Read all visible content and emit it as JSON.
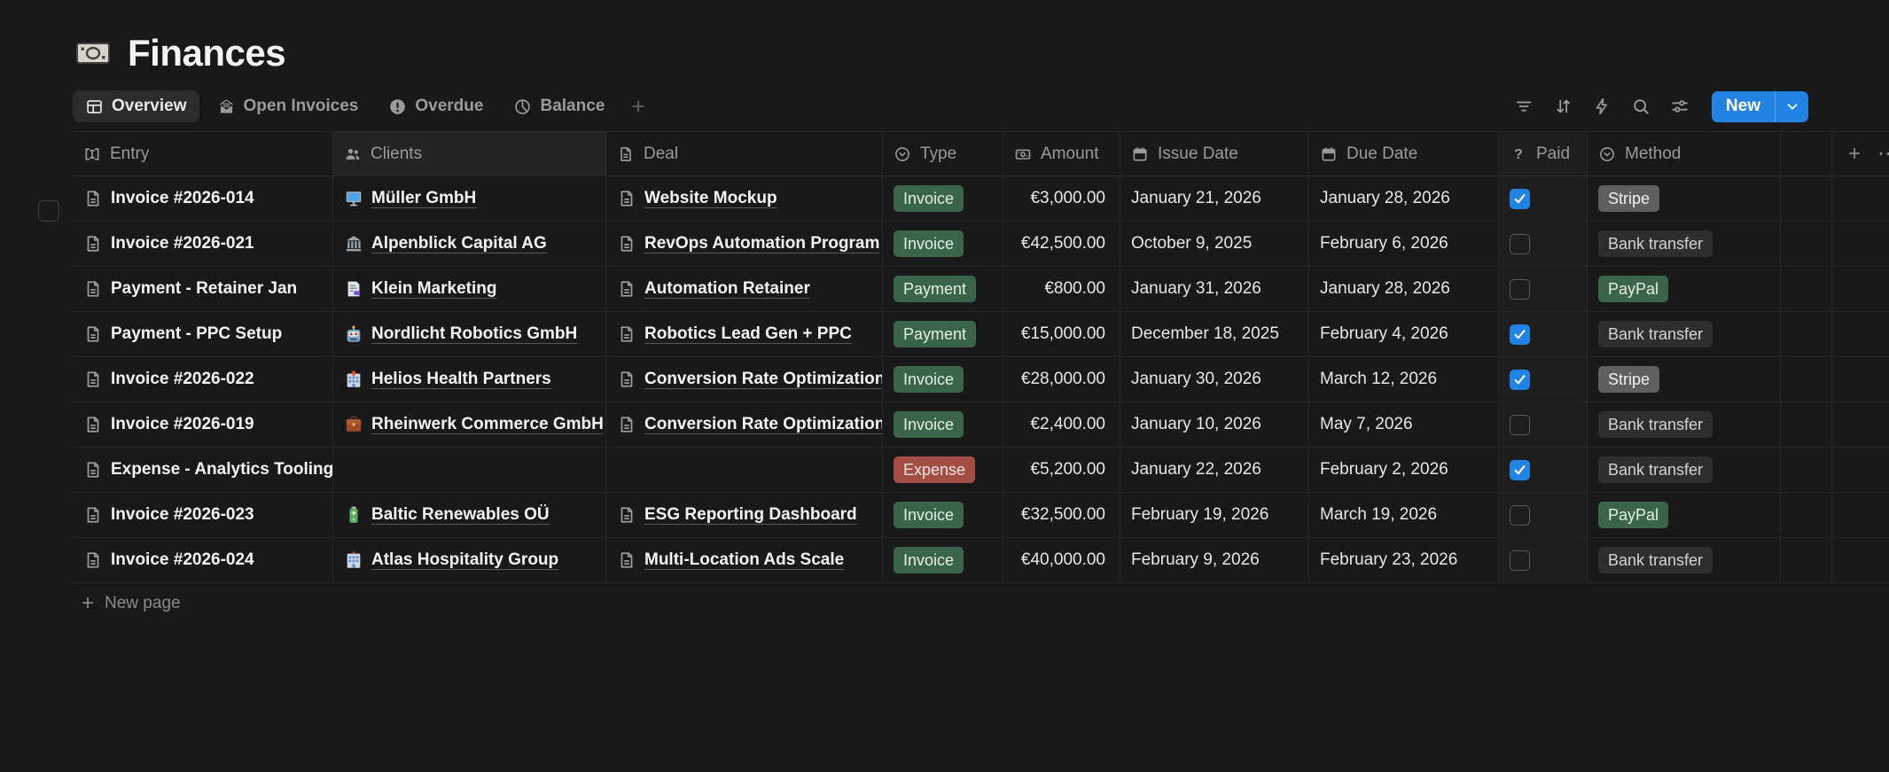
{
  "page": {
    "title": "Finances",
    "icon": "banknote-emoji-icon"
  },
  "tabs": [
    {
      "label": "Overview",
      "icon": "table-icon",
      "active": true
    },
    {
      "label": "Open Invoices",
      "icon": "envelope-icon",
      "active": false
    },
    {
      "label": "Overdue",
      "icon": "alert-icon",
      "active": false
    },
    {
      "label": "Balance",
      "icon": "pie-icon",
      "active": false
    }
  ],
  "toolbar": {
    "icons": [
      "filter-icon",
      "sort-icon",
      "bolt-icon",
      "search-icon",
      "sliders-icon"
    ],
    "new_label": "New"
  },
  "table": {
    "columns": [
      {
        "key": "entry",
        "label": "Entry",
        "icon": "title-icon"
      },
      {
        "key": "client",
        "label": "Clients",
        "icon": "people-icon"
      },
      {
        "key": "deal",
        "label": "Deal",
        "icon": "page-icon"
      },
      {
        "key": "type",
        "label": "Type",
        "icon": "select-icon"
      },
      {
        "key": "amount",
        "label": "Amount",
        "icon": "banknote-icon"
      },
      {
        "key": "issue",
        "label": "Issue Date",
        "icon": "calendar-icon"
      },
      {
        "key": "due",
        "label": "Due Date",
        "icon": "calendar-icon"
      },
      {
        "key": "paid",
        "label": "Paid",
        "icon": "question-icon"
      },
      {
        "key": "method",
        "label": "Method",
        "icon": "select-icon"
      }
    ],
    "rows": [
      {
        "entry": "Invoice #2026-014",
        "client_icon": "desktop-icon",
        "client": "Müller GmbH",
        "deal": "Website Mockup",
        "type": "Invoice",
        "type_color": "green",
        "amount": "€3,000.00",
        "issue_date": "January 21, 2026",
        "due_date": "January 28, 2026",
        "paid": true,
        "method": "Stripe",
        "method_color": "gray"
      },
      {
        "entry": "Invoice #2026-021",
        "client_icon": "bank-icon",
        "client": "Alpenblick Capital AG",
        "deal": "RevOps Automation Program",
        "type": "Invoice",
        "type_color": "green",
        "amount": "€42,500.00",
        "issue_date": "October 9, 2025",
        "due_date": "February 6, 2026",
        "paid": false,
        "method": "Bank transfer",
        "method_color": "dark"
      },
      {
        "entry": "Payment - Retainer Jan",
        "client_icon": "memo-icon",
        "client": "Klein Marketing",
        "deal": "Automation Retainer",
        "type": "Payment",
        "type_color": "green",
        "amount": "€800.00",
        "issue_date": "January 31, 2026",
        "due_date": "January 28, 2026",
        "paid": false,
        "method": "PayPal",
        "method_color": "green"
      },
      {
        "entry": "Payment - PPC Setup",
        "client_icon": "robot-icon",
        "client": "Nordlicht Robotics GmbH",
        "deal": "Robotics Lead Gen + PPC",
        "type": "Payment",
        "type_color": "green",
        "amount": "€15,000.00",
        "issue_date": "December 18, 2025",
        "due_date": "February 4, 2026",
        "paid": true,
        "method": "Bank transfer",
        "method_color": "dark"
      },
      {
        "entry": "Invoice #2026-022",
        "client_icon": "hospital-icon",
        "client": "Helios Health Partners",
        "deal": "Conversion Rate Optimization",
        "type": "Invoice",
        "type_color": "green",
        "amount": "€28,000.00",
        "issue_date": "January 30, 2026",
        "due_date": "March 12, 2026",
        "paid": true,
        "method": "Stripe",
        "method_color": "gray"
      },
      {
        "entry": "Invoice #2026-019",
        "client_icon": "briefcase-icon",
        "client": "Rheinwerk Commerce GmbH",
        "deal": "Conversion Rate Optimization",
        "type": "Invoice",
        "type_color": "green",
        "amount": "€2,400.00",
        "issue_date": "January 10, 2026",
        "due_date": "May 7, 2026",
        "paid": false,
        "method": "Bank transfer",
        "method_color": "dark"
      },
      {
        "entry": "Expense - Analytics Tooling",
        "client_icon": null,
        "client": null,
        "deal": null,
        "type": "Expense",
        "type_color": "red",
        "amount": "€5,200.00",
        "issue_date": "January 22, 2026",
        "due_date": "February 2, 2026",
        "paid": true,
        "method": "Bank transfer",
        "method_color": "dark"
      },
      {
        "entry": "Invoice #2026-023",
        "client_icon": "battery-icon",
        "client": "Baltic Renewables OÜ",
        "deal": "ESG Reporting Dashboard",
        "type": "Invoice",
        "type_color": "green",
        "amount": "€32,500.00",
        "issue_date": "February 19, 2026",
        "due_date": "March 19, 2026",
        "paid": false,
        "method": "PayPal",
        "method_color": "green"
      },
      {
        "entry": "Invoice #2026-024",
        "client_icon": "hotel-icon",
        "client": "Atlas Hospitality Group",
        "deal": "Multi-Location Ads Scale",
        "type": "Invoice",
        "type_color": "green",
        "amount": "€40,000.00",
        "issue_date": "February 9, 2026",
        "due_date": "February 23, 2026",
        "paid": false,
        "method": "Bank transfer",
        "method_color": "dark"
      }
    ]
  },
  "footer": {
    "new_page_label": "New page"
  },
  "colors": {
    "background": "#191919",
    "accent_blue": "#2383e2",
    "badge_green": "#3a654a",
    "badge_red": "#a34d44",
    "badge_gray": "#5f5f5f",
    "badge_dark": "#2e2e2e"
  }
}
